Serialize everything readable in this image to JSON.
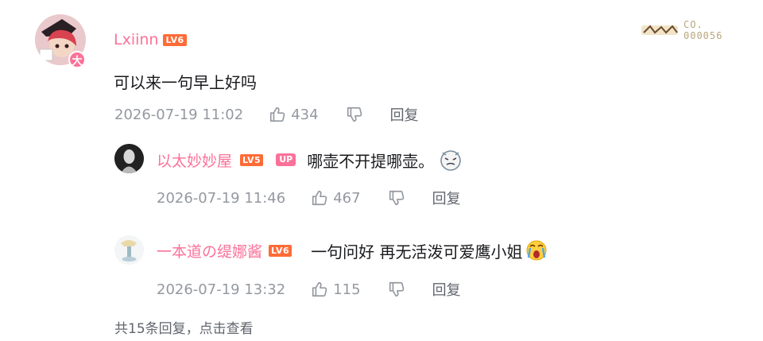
{
  "comment": {
    "user": "Lxiinn",
    "level": "LV6",
    "avatar_badge": "大",
    "text": "可以来一句早上好吗",
    "time": "2026-07-19 11:02",
    "likes": "434",
    "reply_label": "回复",
    "decoration_no_prefix": "CO.",
    "decoration_no": "000056"
  },
  "replies": [
    {
      "user": "以太妙妙屋",
      "level": "LV5",
      "badge": "UP",
      "text": "哪壶不开提哪壶。",
      "time": "2026-07-19 11:46",
      "likes": "467",
      "reply_label": "回复"
    },
    {
      "user": "一本道の缇娜酱",
      "level": "LV6",
      "text": "一句问好 再无活泼可爱鹰小姐",
      "time": "2026-07-19 13:32",
      "likes": "115",
      "reply_label": "回复"
    }
  ],
  "footer": {
    "text": "共15条回复，点击查看"
  },
  "colors": {
    "username": "#fb7299",
    "level": "#ff6b37",
    "meta": "#9499a0"
  }
}
